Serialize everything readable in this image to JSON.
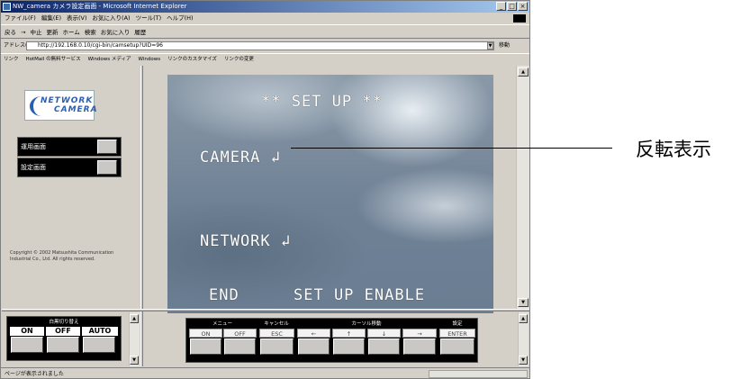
{
  "window": {
    "title": "NW_camera カメラ設定画面 - Microsoft Internet Explorer",
    "minimize_label": "_",
    "maximize_label": "□",
    "close_label": "×"
  },
  "menu": [
    "ファイル(F)",
    "編集(E)",
    "表示(V)",
    "お気に入り(A)",
    "ツール(T)",
    "ヘルプ(H)"
  ],
  "toolbar": [
    "戻る",
    "→",
    "中止",
    "更新",
    "ホーム",
    "検索",
    "お気に入り",
    "履歴"
  ],
  "address": {
    "label": "アドレス(D)",
    "url": "http://192.168.0.10/cgi-bin/camsetup?UID=96",
    "go_label": "移動"
  },
  "links": {
    "label": "リンク",
    "items": [
      "HotMail の無料サービス",
      "Windows メディア",
      "Windows",
      "リンクのカスタマイズ",
      "リンクの変更"
    ]
  },
  "left_panel": {
    "logo_line1": "NETWORK",
    "logo_line2": "CAMERA",
    "nav": [
      {
        "label": "運用画面"
      },
      {
        "label": "設定画面"
      }
    ],
    "copyright": "Copyright © 2002 Matsushita Communication Industrial Co., Ltd. All rights reserved."
  },
  "camera_osd": {
    "title": "** SET UP **",
    "camera_item": "CAMERA ↲",
    "network_item": "NETWORK ↲",
    "end": "END",
    "setup_enable": "SET UP ENABLE"
  },
  "power_control": {
    "header": "白黒切り替え",
    "buttons": [
      "ON",
      "OFF",
      "AUTO"
    ]
  },
  "camera_control": {
    "headers": [
      "メニュー",
      "キャンセル",
      "カーソル移動",
      "設定"
    ],
    "buttons": [
      "ON",
      "OFF",
      "ESC",
      "←",
      "↑",
      "↓",
      "→",
      "ENTER"
    ]
  },
  "status": {
    "text": "ページが表示されました"
  },
  "annotation": {
    "callout": "反転表示"
  }
}
